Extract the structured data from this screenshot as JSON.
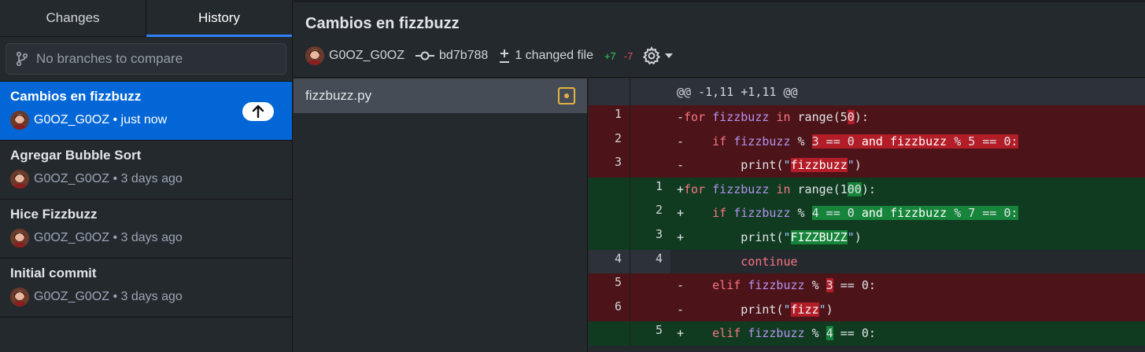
{
  "tabs": {
    "changes": "Changes",
    "history": "History"
  },
  "branch_compare": {
    "placeholder": "No branches to compare"
  },
  "commits": [
    {
      "title": "Cambios en fizzbuzz",
      "author": "G0OZ_G0OZ",
      "time": "just now",
      "selected": true
    },
    {
      "title": "Agregar Bubble Sort",
      "author": "G0OZ_G0OZ",
      "time": "3 days ago"
    },
    {
      "title": "Hice Fizzbuzz",
      "author": "G0OZ_G0OZ",
      "time": "3 days ago"
    },
    {
      "title": "Initial commit",
      "author": "G0OZ_G0OZ",
      "time": "3 days ago"
    }
  ],
  "header": {
    "title": "Cambios en fizzbuzz",
    "author": "G0OZ_G0OZ",
    "sha": "bd7b788",
    "changed_files": "1 changed file",
    "additions": "+7",
    "deletions": "-7"
  },
  "files": [
    {
      "name": "fizzbuzz.py",
      "status": "modified"
    }
  ],
  "diff": {
    "hunk_header": "@@ -1,11 +1,11 @@",
    "lines": [
      {
        "type": "del",
        "old": "1",
        "new": "",
        "text": "-for fizzbuzz in range(50):"
      },
      {
        "type": "del",
        "old": "2",
        "new": "",
        "text": "-    if fizzbuzz % 3 == 0 and fizzbuzz % 5 == 0:"
      },
      {
        "type": "del",
        "old": "3",
        "new": "",
        "text": "-        print(\"fizzbuzz\")"
      },
      {
        "type": "add",
        "old": "",
        "new": "1",
        "text": "+for fizzbuzz in range(100):"
      },
      {
        "type": "add",
        "old": "",
        "new": "2",
        "text": "+    if fizzbuzz % 4 == 0 and fizzbuzz % 7 == 0:"
      },
      {
        "type": "add",
        "old": "",
        "new": "3",
        "text": "+        print(\"FIZZBUZZ\")"
      },
      {
        "type": "ctx",
        "old": "4",
        "new": "4",
        "text": "         continue"
      },
      {
        "type": "del",
        "old": "5",
        "new": "",
        "text": "-    elif fizzbuzz % 3 == 0:"
      },
      {
        "type": "del",
        "old": "6",
        "new": "",
        "text": "-        print(\"fizz\")"
      },
      {
        "type": "add",
        "old": "",
        "new": "5",
        "text": "+    elif fizzbuzz % 4 == 0:"
      }
    ]
  },
  "colors": {
    "accent": "#0366d6",
    "added": "#34d058",
    "deleted": "#ea4a5a",
    "modified": "#e3b341"
  },
  "icons": [
    "git-branch-icon",
    "arrow-up-icon",
    "git-commit-icon",
    "diff-icon",
    "gear-icon",
    "caret-down-icon",
    "file-modified-icon"
  ]
}
